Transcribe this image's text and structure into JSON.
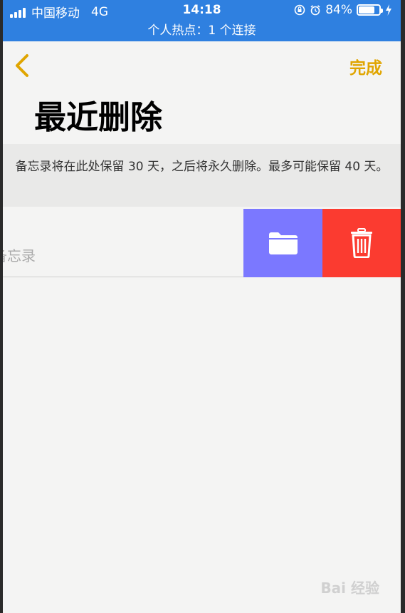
{
  "status_bar": {
    "carrier": "中国移动",
    "network": "4G",
    "time": "14:18",
    "battery": "84%",
    "battery_level": 0.84
  },
  "hotspot_banner": "个人热点：1 个连接",
  "nav": {
    "done_label": "完成"
  },
  "page": {
    "title": "最近删除",
    "info_text": "备忘录将在此处保留 30 天，之后将永久删除。最多可能保留 40 天。"
  },
  "note_row": {
    "text": "备忘录",
    "actions": [
      "folder-icon",
      "trash-icon"
    ]
  },
  "colors": {
    "accent": "#e0a500",
    "status_bar": "#2f80e0",
    "move_action": "#7b78ff",
    "delete_action": "#fb3b30"
  },
  "watermark": "Bai 经验"
}
